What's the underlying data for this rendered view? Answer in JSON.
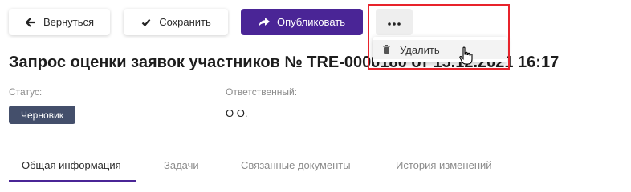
{
  "toolbar": {
    "back_label": "Вернуться",
    "save_label": "Сохранить",
    "publish_label": "Опубликовать"
  },
  "dropdown": {
    "items": [
      {
        "label": "Удалить",
        "icon": "trash-icon"
      }
    ]
  },
  "page": {
    "title": "Запрос оценки заявок участников № TRE-0000180 от 15.12.2021 16:17"
  },
  "fields": {
    "status_label": "Статус:",
    "status_value": "Черновик",
    "owner_label": "Ответственный:",
    "owner_value": "О О."
  },
  "tabs": [
    {
      "label": "Общая информация",
      "active": true
    },
    {
      "label": "Задачи"
    },
    {
      "label": "Связанные документы"
    },
    {
      "label": "История изменений"
    }
  ],
  "colors": {
    "primary": "#4a2596",
    "badge": "#444f6b",
    "highlight": "#e8232b"
  }
}
